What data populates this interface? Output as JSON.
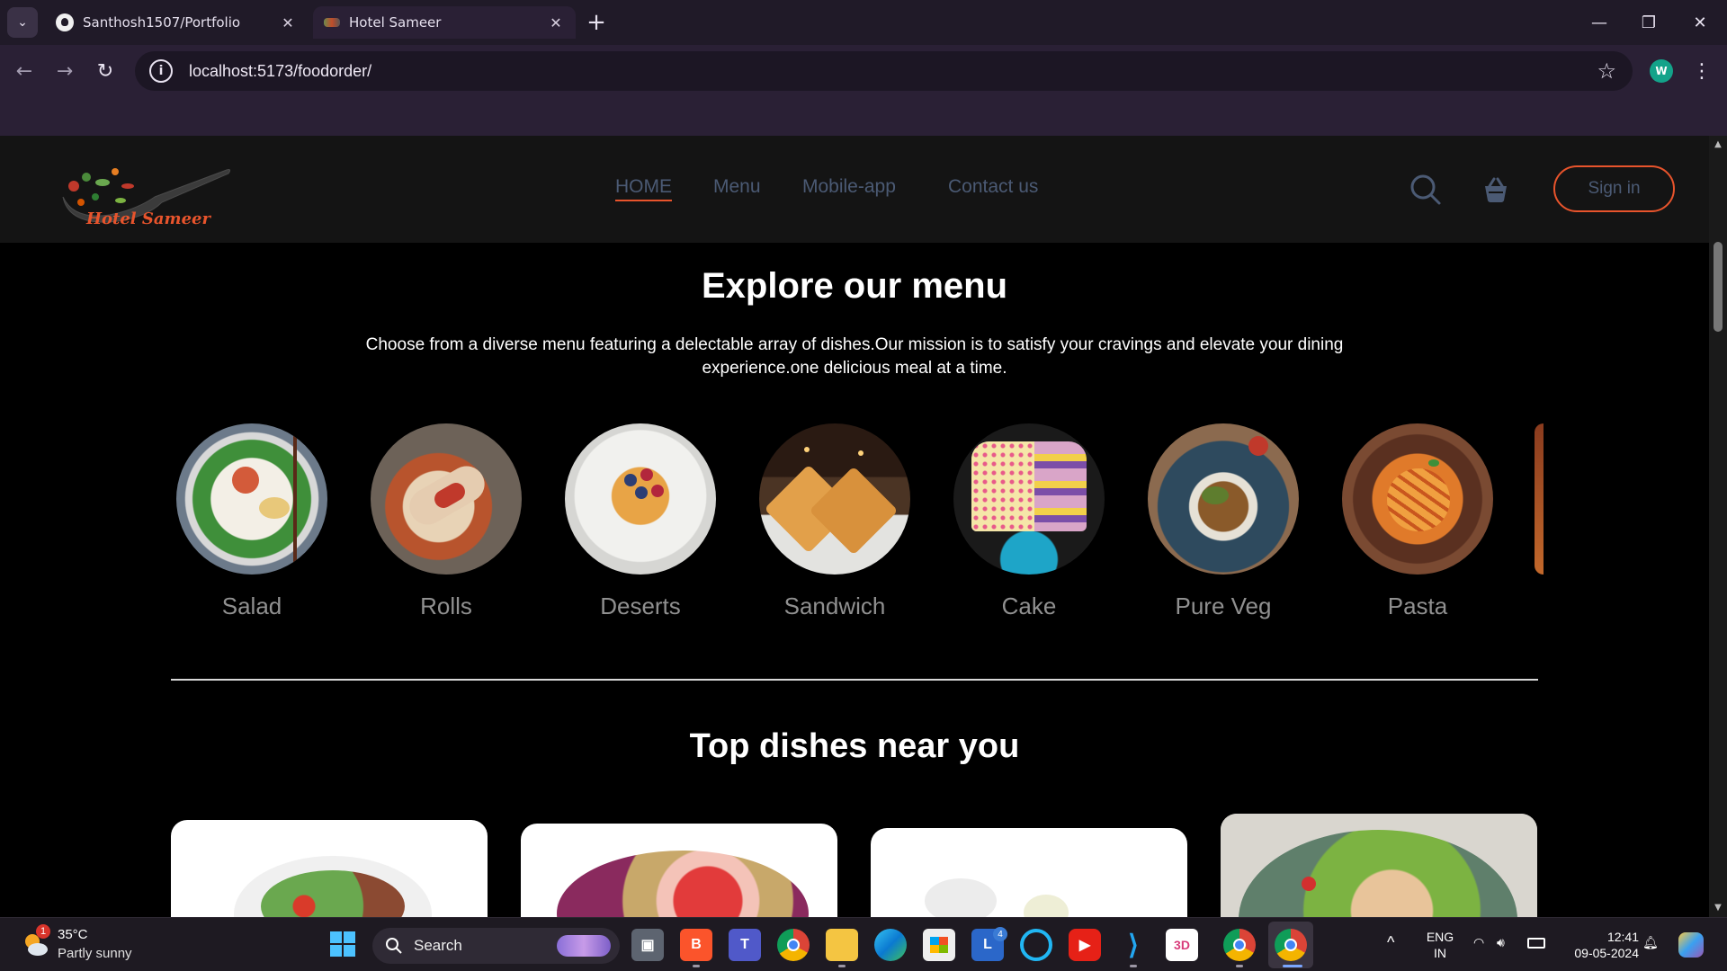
{
  "browser": {
    "tabs": [
      {
        "title": "Santhosh1507/Portfolio",
        "favicon": "github-icon",
        "active": false
      },
      {
        "title": "Hotel Sameer",
        "favicon": "hotel-favicon",
        "active": true
      }
    ],
    "url": "localhost:5173/foodorder/",
    "profile_initial": "W"
  },
  "site": {
    "brand": "Hotel Sameer",
    "nav": [
      {
        "label": "HOME",
        "active": true
      },
      {
        "label": "Menu",
        "active": false
      },
      {
        "label": "Mobile-app",
        "active": false
      },
      {
        "label": "Contact us",
        "active": false
      }
    ],
    "signin_label": "Sign in",
    "accent": "#e8542c"
  },
  "explore": {
    "title": "Explore our menu",
    "subtitle": "Choose from a diverse menu featuring a delectable array of dishes.Our mission is to satisfy your cravings and elevate your dining experience.one delicious meal at a time.",
    "items": [
      {
        "label": "Salad"
      },
      {
        "label": "Rolls"
      },
      {
        "label": "Deserts"
      },
      {
        "label": "Sandwich"
      },
      {
        "label": "Cake"
      },
      {
        "label": "Pure Veg"
      },
      {
        "label": "Pasta"
      }
    ]
  },
  "top_dishes": {
    "title": "Top dishes near you"
  },
  "taskbar": {
    "weather_temp": "35°C",
    "weather_desc": "Partly sunny",
    "weather_badge": "1",
    "search_label": "Search",
    "lang_1": "ENG",
    "lang_2": "IN",
    "time": "12:41",
    "date": "09-05-2024",
    "notif_badge": "4"
  }
}
